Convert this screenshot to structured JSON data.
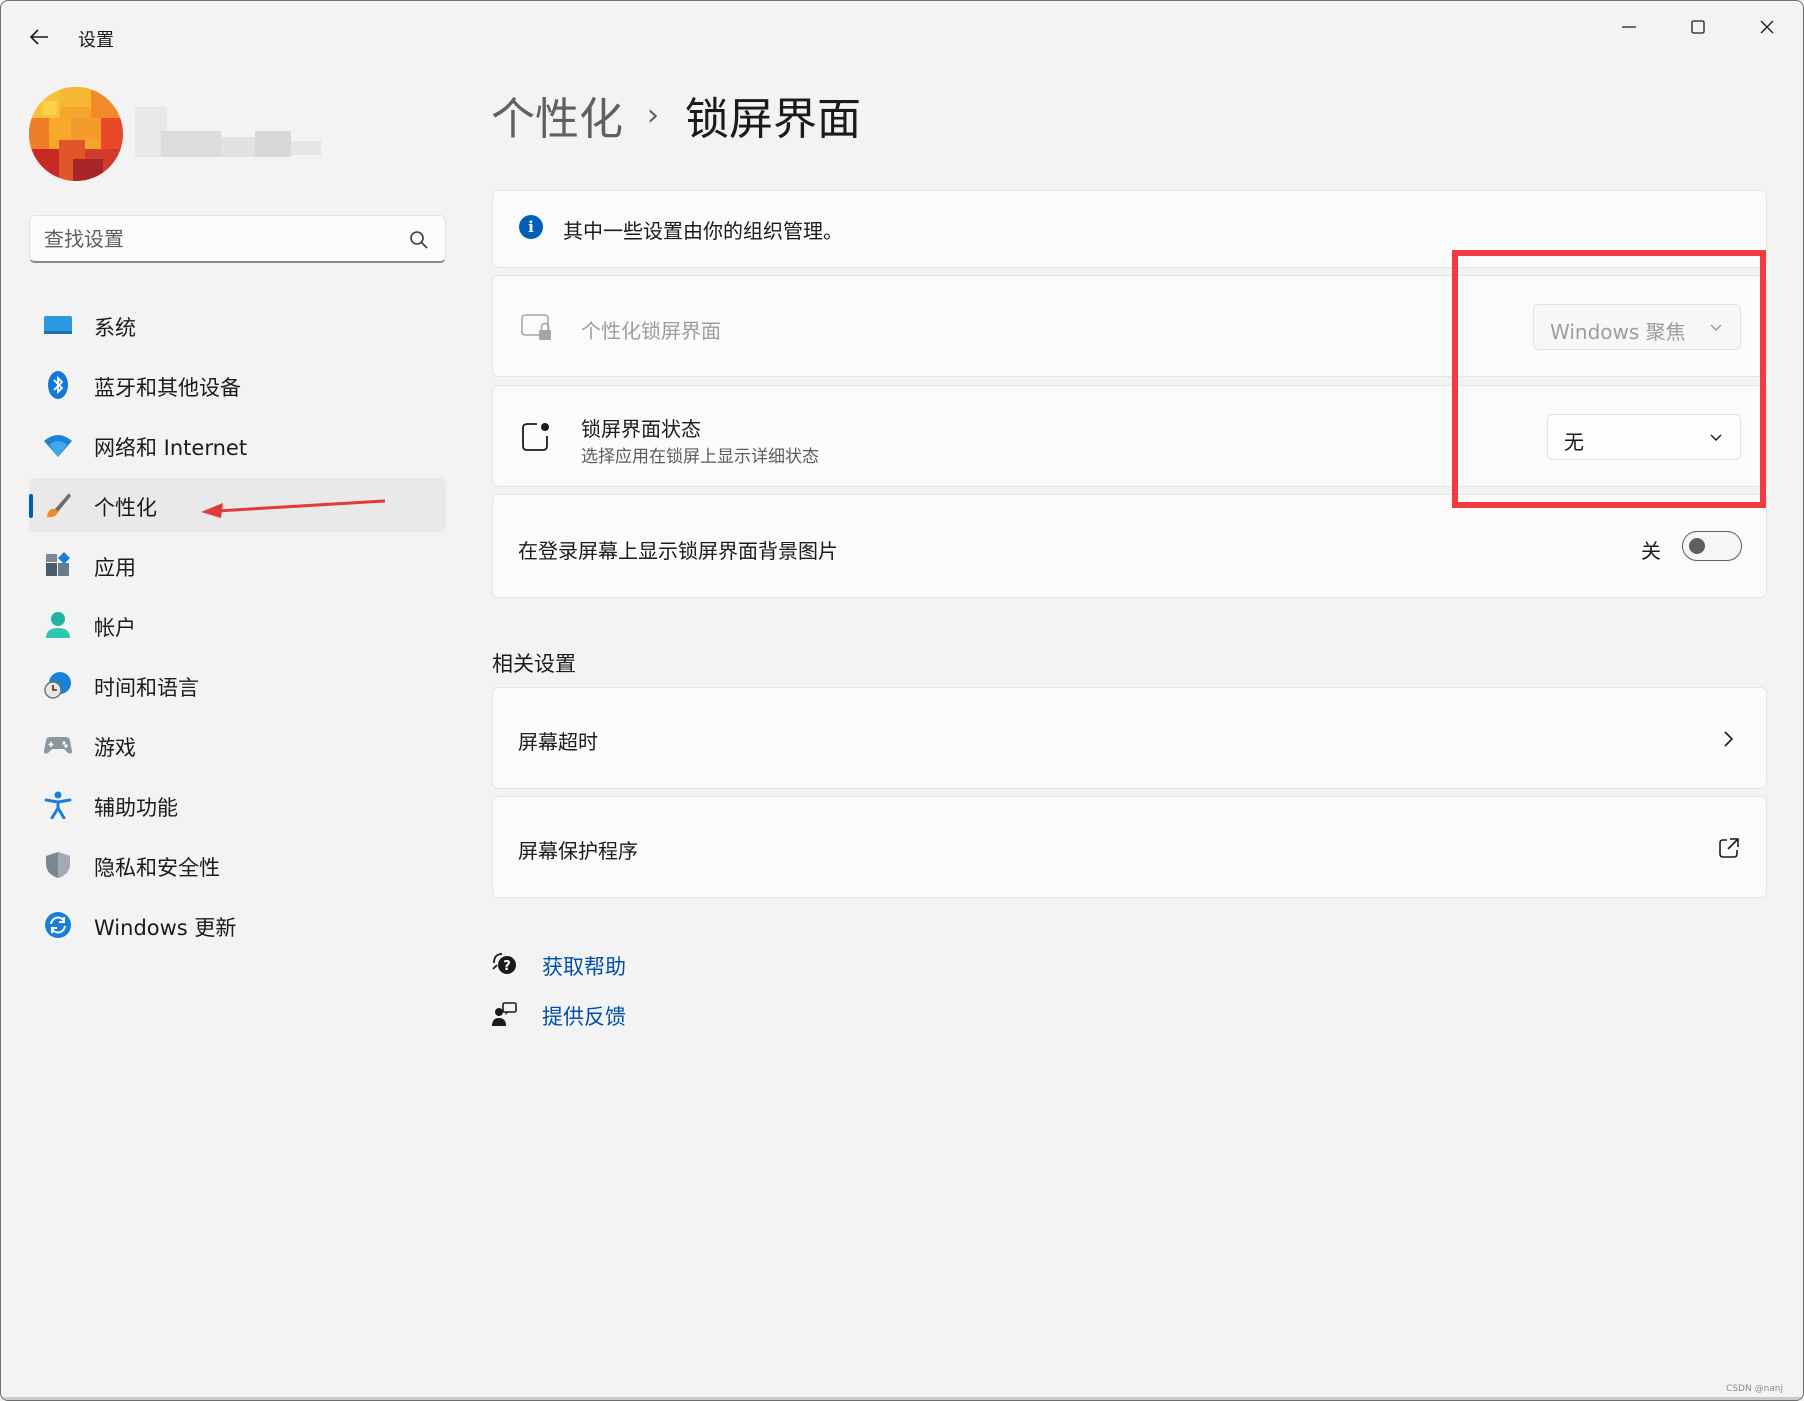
{
  "window": {
    "title": "设置"
  },
  "search": {
    "placeholder": "查找设置"
  },
  "sidebar": {
    "items": [
      {
        "label": "系统",
        "icon": "monitor-icon"
      },
      {
        "label": "蓝牙和其他设备",
        "icon": "bluetooth-icon"
      },
      {
        "label": "网络和 Internet",
        "icon": "wifi-icon"
      },
      {
        "label": "个性化",
        "icon": "brush-icon",
        "active": true
      },
      {
        "label": "应用",
        "icon": "apps-icon"
      },
      {
        "label": "帐户",
        "icon": "account-icon"
      },
      {
        "label": "时间和语言",
        "icon": "globe-clock-icon"
      },
      {
        "label": "游戏",
        "icon": "gamepad-icon"
      },
      {
        "label": "辅助功能",
        "icon": "accessibility-icon"
      },
      {
        "label": "隐私和安全性",
        "icon": "shield-icon"
      },
      {
        "label": "Windows 更新",
        "icon": "update-icon"
      }
    ]
  },
  "breadcrumb": {
    "parent": "个性化",
    "separator": "›",
    "current": "锁屏界面"
  },
  "notice": {
    "text": "其中一些设置由你的组织管理。"
  },
  "settings": {
    "lock_screen_personalize": {
      "title": "个性化锁屏界面",
      "value": "Windows 聚焦",
      "disabled": true
    },
    "lock_screen_status": {
      "title": "锁屏界面状态",
      "subtitle": "选择应用在锁屏上显示详细状态",
      "value": "无"
    },
    "show_background_on_signin": {
      "title": "在登录屏幕上显示锁屏界面背景图片",
      "state_label": "关",
      "on": false
    }
  },
  "related": {
    "heading": "相关设置",
    "items": [
      {
        "label": "屏幕超时",
        "icon": "chevron-right-icon"
      },
      {
        "label": "屏幕保护程序",
        "icon": "external-link-icon"
      }
    ]
  },
  "help": {
    "get_help": "获取帮助",
    "feedback": "提供反馈"
  },
  "colors": {
    "accent": "#005fb8",
    "link": "#0050a8",
    "annotation": "#f23a3f"
  },
  "watermark": "CSDN @nanj"
}
